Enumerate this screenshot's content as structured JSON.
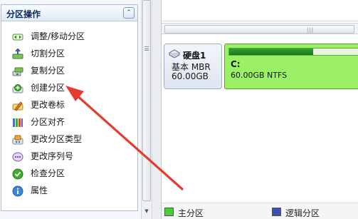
{
  "panel": {
    "title": "分区操作",
    "collapse_icon": "double-chevron-up-icon",
    "items": [
      {
        "label": "调整/移动分区",
        "icon": "resize-move-icon"
      },
      {
        "label": "切割分区",
        "icon": "split-partition-icon"
      },
      {
        "label": "复制分区",
        "icon": "copy-partition-icon"
      },
      {
        "label": "创建分区",
        "icon": "create-partition-icon"
      },
      {
        "label": "更改卷标",
        "icon": "change-label-icon"
      },
      {
        "label": "分区对齐",
        "icon": "align-partition-icon"
      },
      {
        "label": "更改分区类型",
        "icon": "change-type-icon"
      },
      {
        "label": "更改序列号",
        "icon": "change-serial-icon"
      },
      {
        "label": "检查分区",
        "icon": "check-partition-icon"
      },
      {
        "label": "属性",
        "icon": "properties-icon"
      }
    ]
  },
  "disk": {
    "name": "硬盘1",
    "type": "基本 MBR",
    "size": "60.00GB",
    "partition": {
      "letter": "C:",
      "description": "60.00GB NTFS",
      "used_fraction": 0.63,
      "color": "#9cf066"
    }
  },
  "legend": [
    {
      "label": "主分区",
      "color": "#4ecb3d"
    },
    {
      "label": "逻辑分区",
      "color": "#3a4fb8"
    }
  ],
  "annotation": {
    "type": "red-arrow",
    "points_to": "创建分区",
    "color": "#e53a2e"
  }
}
